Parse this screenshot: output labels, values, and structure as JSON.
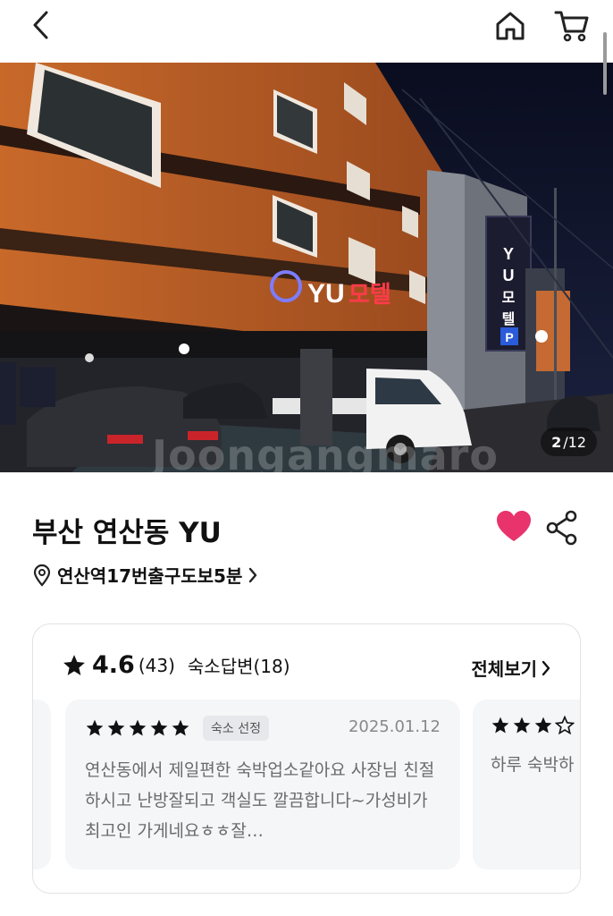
{
  "header": {
    "back_icon": "chevron-left-icon",
    "home_icon": "home-icon",
    "cart_icon": "cart-icon"
  },
  "gallery": {
    "current": "2",
    "total": "/12",
    "watermark": "Joongangmaro",
    "sign_text": "YU 모텔",
    "vertical_sign": [
      "Y",
      "U",
      "모",
      "텔",
      "P"
    ]
  },
  "property": {
    "title": "부산 연산동 YU",
    "location": "연산역17번출구도보5분",
    "favorite": true,
    "accent_color": "#e8336d"
  },
  "reviews": {
    "rating": "4.6",
    "count": "(43)",
    "host_replies": "숙소답변(18)",
    "see_all": "전체보기",
    "items": [
      {
        "stars": 5,
        "badge": "숙소 선정",
        "date": "2025.01.12",
        "text": "연산동에서 제일편한 숙박업소같아요 사장님 친절하시고 난방잘되고 객실도 깔끔합니다~가성비가 최고인 가게네요ㅎㅎ잘…"
      },
      {
        "stars": 3,
        "text": "하루 숙박하"
      }
    ]
  }
}
